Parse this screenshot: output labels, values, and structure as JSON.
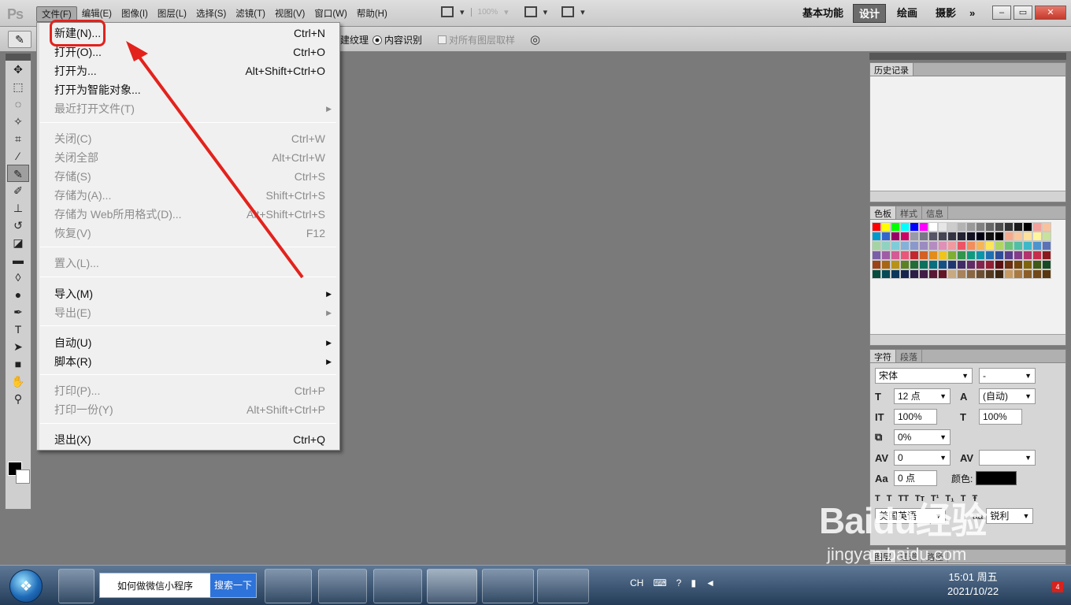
{
  "app": {
    "logo": "Ps"
  },
  "menubar": {
    "items": [
      "文件(F)",
      "编辑(E)",
      "图像(I)",
      "图层(L)",
      "选择(S)",
      "滤镜(T)",
      "视图(V)",
      "窗口(W)",
      "帮助(H)"
    ],
    "zoom": "100%",
    "workspaces": [
      "基本功能",
      "设计",
      "绘画",
      "摄影"
    ],
    "more": "»"
  },
  "options": {
    "texture_label": "建纹理",
    "content_aware_label": "内容识别",
    "sample_all_label": "对所有图层取样"
  },
  "file_menu": {
    "items": [
      {
        "label": "新建(N)...",
        "shortcut": "Ctrl+N"
      },
      {
        "label": "打开(O)...",
        "shortcut": "Ctrl+O"
      },
      {
        "label": "打开为...",
        "shortcut": "Alt+Shift+Ctrl+O"
      },
      {
        "label": "打开为智能对象...",
        "shortcut": ""
      },
      {
        "label": "最近打开文件(T)",
        "shortcut": ""
      },
      {
        "label": "关闭(C)",
        "shortcut": "Ctrl+W"
      },
      {
        "label": "关闭全部",
        "shortcut": "Alt+Ctrl+W"
      },
      {
        "label": "存储(S)",
        "shortcut": "Ctrl+S"
      },
      {
        "label": "存储为(A)...",
        "shortcut": "Shift+Ctrl+S"
      },
      {
        "label": "存储为 Web所用格式(D)...",
        "shortcut": "Alt+Shift+Ctrl+S"
      },
      {
        "label": "恢复(V)",
        "shortcut": "F12"
      },
      {
        "label": "置入(L)...",
        "shortcut": ""
      },
      {
        "label": "导入(M)",
        "shortcut": ""
      },
      {
        "label": "导出(E)",
        "shortcut": ""
      },
      {
        "label": "自动(U)",
        "shortcut": ""
      },
      {
        "label": "脚本(R)",
        "shortcut": ""
      },
      {
        "label": "打印(P)...",
        "shortcut": "Ctrl+P"
      },
      {
        "label": "打印一份(Y)",
        "shortcut": "Alt+Shift+Ctrl+P"
      },
      {
        "label": "退出(X)",
        "shortcut": "Ctrl+Q"
      }
    ]
  },
  "panels": {
    "history_tab": "历史记录",
    "swatch_tabs": [
      "色板",
      "样式",
      "信息"
    ],
    "char_tabs": [
      "字符",
      "段落"
    ],
    "font_family": "宋体",
    "font_style": "-",
    "font_size": "12 点",
    "leading": "(自动)",
    "vscale": "100%",
    "hscale": "100%",
    "tracking_pct": "0%",
    "kerning": "0",
    "baseline": "0 点",
    "color_label": "颜色:",
    "language": "美国英语",
    "aa": "锐利",
    "bottom_tabs": [
      "图层",
      "通道",
      "路径"
    ],
    "swatch_colors": [
      "#ff0000",
      "#ffff00",
      "#00ff00",
      "#00ffff",
      "#0000ff",
      "#ff00ff",
      "#ffffff",
      "#e6e6e6",
      "#cccccc",
      "#b3b3b3",
      "#999999",
      "#808080",
      "#666666",
      "#4d4d4d",
      "#333333",
      "#1a1a1a",
      "#000000",
      "#f5a09a",
      "#f9c29c",
      "#0099cc",
      "#3366cc",
      "#990066",
      "#cc0066",
      "#9999aa",
      "#777788",
      "#555566",
      "#444455",
      "#333344",
      "#222233",
      "#111122",
      "#000011",
      "#111111",
      "#000000",
      "#f7a98b",
      "#fbc79a",
      "#fde29d",
      "#fff59d",
      "#c6e29b",
      "#a5d4a3",
      "#8fd2c0",
      "#7fccd8",
      "#83b1d9",
      "#8a98cc",
      "#9b8bc0",
      "#b58cc0",
      "#e08fb6",
      "#f09aa0",
      "#ed5565",
      "#f28e5c",
      "#f7b556",
      "#fce559",
      "#b0d563",
      "#6dc37a",
      "#4fbfa5",
      "#3eb8c8",
      "#4d94cf",
      "#5b72b7",
      "#7a5fa8",
      "#a05da7",
      "#d35a94",
      "#e8567a",
      "#c1272d",
      "#d35f24",
      "#e28c1b",
      "#f0c419",
      "#7fae32",
      "#31954b",
      "#0f9a7f",
      "#0a95a9",
      "#1f6fb1",
      "#2e4d98",
      "#5a3d8c",
      "#853b8c",
      "#b2336d",
      "#c62f4b",
      "#8b1a1e",
      "#9c4418",
      "#a96612",
      "#b89215",
      "#5d8125",
      "#226d36",
      "#0b715d",
      "#086d7c",
      "#155083",
      "#1f3670",
      "#402b67",
      "#612b67",
      "#83244f",
      "#921f36",
      "#5c0f12",
      "#6b2e10",
      "#74450b",
      "#7f640e",
      "#3f5918",
      "#164a24",
      "#064c3f",
      "#054a55",
      "#0d375a",
      "#15244c",
      "#2b1d46",
      "#421d46",
      "#591835",
      "#631524",
      "#c9a97f",
      "#a7825a",
      "#8a6642",
      "#6e4e30",
      "#55391f",
      "#3d2611",
      "#c79a61",
      "#a97a40",
      "#8b5e27",
      "#714818",
      "#58360e"
    ]
  },
  "taskbar": {
    "search_text": "如何做微信小程序",
    "search_btn": "搜索一下",
    "lang": "CH",
    "time": "15:01 周五",
    "date": "2021/10/22",
    "badge": "4"
  },
  "watermark": {
    "big": "Baidu经验",
    "small": "jingyan.baidu.com"
  }
}
